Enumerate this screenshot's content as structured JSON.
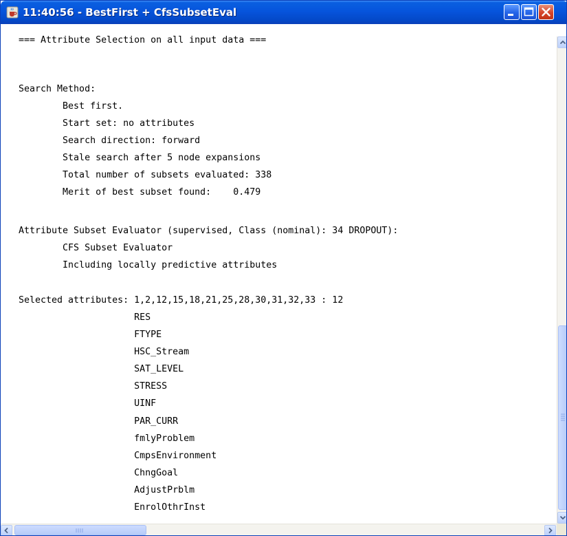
{
  "window": {
    "title": "11:40:56 - BestFirst + CfsSubsetEval",
    "icon": "java-cup-icon",
    "buttons": [
      "minimize-icon",
      "maximize-icon",
      "close-icon"
    ]
  },
  "output": {
    "lines": [
      "=== Attribute Selection on all input data ===",
      "",
      "Search Method:",
      "\tBest first.",
      "\tStart set: no attributes",
      "\tSearch direction: forward",
      "\tStale search after 5 node expansions",
      "\tTotal number of subsets evaluated: 338",
      "\tMerit of best subset found:    0.479",
      "",
      "Attribute Subset Evaluator (supervised, Class (nominal): 34 DROPOUT):",
      "\tCFS Subset Evaluator",
      "\tIncluding locally predictive attributes",
      "",
      "Selected attributes: 1,2,12,15,18,21,25,28,30,31,32,33 : 12",
      "                     RES",
      "                     FTYPE",
      "                     HSC_Stream",
      "                     SAT_LEVEL",
      "                     STRESS",
      "                     UINF",
      "                     PAR_CURR",
      "                     fmlyProblem",
      "                     CmpsEnvironment",
      "                     ChngGoal",
      "                     AdjustPrblm",
      "                     EnrolOthrInst"
    ]
  },
  "scroll": {
    "vertical_position": 0.93,
    "horizontal_position": 0.0
  },
  "colors": {
    "titlebar": "#0654dc",
    "close_button": "#d5442a",
    "text": "#000000"
  }
}
